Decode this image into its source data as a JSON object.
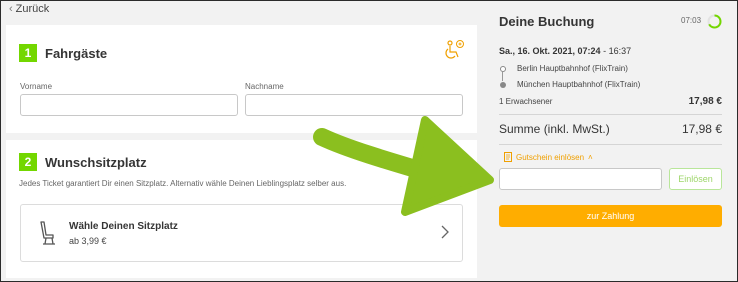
{
  "nav": {
    "back_label": "Zurück"
  },
  "passengers": {
    "step": "1",
    "title": "Fahrgäste",
    "first_name_label": "Vorname",
    "first_name_value": "",
    "last_name_label": "Nachname",
    "last_name_value": ""
  },
  "seat": {
    "step": "2",
    "title": "Wunschsitzplatz",
    "description": "Jedes Ticket garantiert Dir einen Sitzplatz. Alternativ wähle Deinen Lieblingsplatz selber aus.",
    "option_title": "Wähle Deinen Sitzplatz",
    "option_price": "ab 3,99 €"
  },
  "booking": {
    "title": "Deine Buchung",
    "timer": "07:03",
    "date_bold": "Sa., 16. Okt. 2021, 07:24",
    "date_rest": " - 16:37",
    "from": "Berlin Hauptbahnhof (FlixTrain)",
    "to": "München Hauptbahnhof (FlixTrain)",
    "passenger_line": "1 Erwachsener",
    "passenger_price": "17,98 €",
    "total_label": "Summe",
    "total_note": "(inkl. MwSt.)",
    "total_price": "17,98 €",
    "voucher_toggle": "Gutschein einlösen",
    "voucher_value": "",
    "redeem_label": "Einlösen",
    "pay_label": "zur Zahlung"
  },
  "colors": {
    "accent_green": "#73d700",
    "accent_orange": "#ffad00",
    "annotation_arrow": "#8bbf1f"
  }
}
